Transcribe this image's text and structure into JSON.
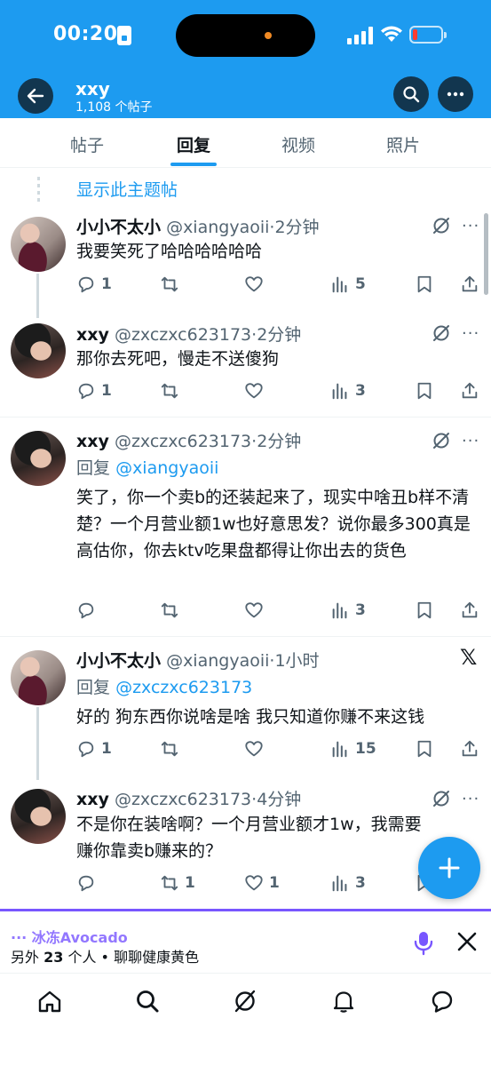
{
  "status_bar": {
    "time": "00:20"
  },
  "header": {
    "name": "xxy",
    "post_count": "1,108 个帖子"
  },
  "tabs": [
    {
      "label": "帖子"
    },
    {
      "label": "回复"
    },
    {
      "label": "视频"
    },
    {
      "label": "照片"
    }
  ],
  "show_thread": "显示此主题帖",
  "posts": [
    {
      "name": "小小不太小",
      "handle": "@xiangyaoii",
      "time": "·2分钟",
      "reply_to": "",
      "text": "我要笑死了哈哈哈哈哈哈",
      "replies": "1",
      "reposts": "",
      "likes": "",
      "views": "5"
    },
    {
      "name": "xxy",
      "handle": "@zxczxc623173",
      "time": "·2分钟",
      "reply_to": "",
      "text": "那你去死吧，慢走不送傻狗",
      "replies": "1",
      "reposts": "",
      "likes": "",
      "views": "3"
    },
    {
      "name": "xxy",
      "handle": "@zxczxc623173",
      "time": "·2分钟",
      "reply_prefix": "回复",
      "reply_to": "@xiangyaoii",
      "text": "笑了，你一个卖b的还装起来了，现实中啥丑b样不清楚？一个月营业额1w也好意思发？说你最多300真是高估你，你去ktv吃果盘都得让你出去的货色",
      "replies": "",
      "reposts": "",
      "likes": "",
      "views": "3"
    },
    {
      "name": "小小不太小",
      "handle": "@xiangyaoii",
      "time": "·1小时",
      "reply_prefix": "回复",
      "reply_to": "@zxczxc623173",
      "text": "好的 狗东西你说啥是啥 我只知道你赚不来这钱",
      "replies": "1",
      "reposts": "",
      "likes": "",
      "views": "15"
    },
    {
      "name": "xxy",
      "handle": "@zxczxc623173",
      "time": "·4分钟",
      "reply_to": "",
      "text": "不是你在装啥啊？一个月营业额才1w，我需要赚你靠卖b赚来的？",
      "replies": "",
      "reposts": "1",
      "likes": "1",
      "views": "3"
    }
  ],
  "more_glyph": "···",
  "x_logo": "𝕏",
  "spaces": {
    "title": "··· 冰冻Avocado",
    "prefix": "另外",
    "count": "23",
    "suffix": "个人 • 聊聊健康黄色"
  },
  "colors": {
    "brand": "#1d9bf0",
    "spaces": "#7856ff",
    "muted": "#536471"
  }
}
